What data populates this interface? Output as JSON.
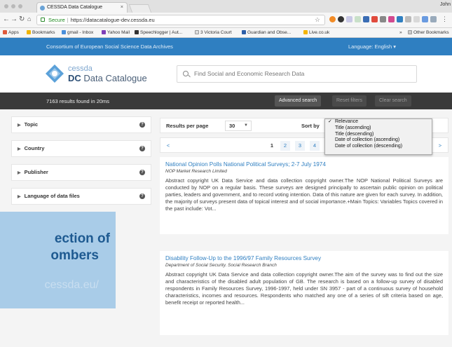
{
  "browser": {
    "tab_title": "CESSDA Data Catalogue",
    "tab_close": "×",
    "profile_name": "John",
    "url_secure_label": "Secure",
    "url": "https://datacatalogue-dev.cessda.eu",
    "bookmarks": [
      "Apps",
      "Bookmarks",
      "gmail - Inbox",
      "Yahoo Mail",
      "Speechlogger | Aut...",
      "3 Victoria Court",
      "Guardian and Obse...",
      "Live.co.uk",
      "»",
      "Other Bookmarks"
    ]
  },
  "header": {
    "consortium": "Consortium of European Social Science Data Archives",
    "language": "Language:  English  ▾",
    "logo_small": "cessda",
    "logo_dc": "DC",
    "logo_catalogue": " Data Catalogue",
    "search_placeholder": "Find Social and Economic Research Data"
  },
  "results_bar": {
    "count": "7163 results found in 20ms",
    "advanced": "Advanced search",
    "reset": "Reset filters",
    "clear": "Clear search"
  },
  "facets": [
    "Topic",
    "Country",
    "Publisher",
    "Language of data files"
  ],
  "controls": {
    "rpp_label": "Results per page",
    "rpp_value": "30",
    "sort_label": "Sort by",
    "sort_options": [
      "Relevance",
      "Title (ascending)",
      "Title (descending)",
      "Date of collection (ascending)",
      "Date of collection (descending)"
    ],
    "sort_selected": "Relevance"
  },
  "pager": {
    "prev": "<",
    "pages": [
      "1",
      "2",
      "3",
      "4"
    ],
    "next": ">"
  },
  "results": [
    {
      "title": "National Opinion Polls National Political Surveys; 2-7 July 1974",
      "publisher": "NOP Market Research Limited",
      "abstract": "Abstract copyright UK Data Service and data collection copyright owner.The NOP National Political Surveys are conducted by NOP on a regular basis. These surveys are designed principally to ascertain public opinion on political parties, leaders and government, and to record voting intention. Data of this nature are given for each survey. In addition, the majority of surveys present data of topical interest and of social importance.+Main Topics: Variables Topics covered in the past include: Vot..."
    },
    {
      "title": "Disability Follow-Up to the 1996/97 Family Resources Survey",
      "publisher": "Department of Social Security. Social Research Branch",
      "abstract": "Abstract copyright UK Data Service and data collection copyright owner.The aim of the survey was to find out the size and characteristics of the disabled adult population of GB. The research is based on a follow-up survey of disabled respondents in Family Resources Survey, 1996-1997, held under SN 3957 - part of a continuous survey of household characteristics, incomes and resources. Respondents who matched any one of a series of sift criteria based on age, benefit receipt or reported health..."
    }
  ],
  "overlay": {
    "line1": "ection of",
    "line2": "ombers",
    "line3": "cessda.eu/"
  },
  "colors": {
    "brand_blue": "#2f7fc1",
    "dark_bar": "#3a3a3a",
    "overlay_blue": "#a9cce8"
  }
}
